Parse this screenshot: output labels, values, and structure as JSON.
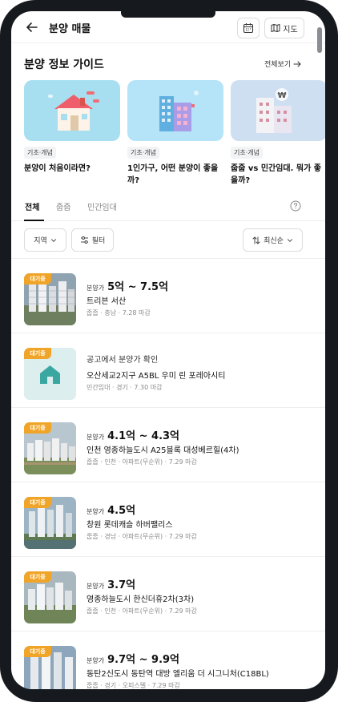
{
  "header": {
    "title": "분양 매물",
    "map_label": "지도"
  },
  "guide": {
    "title": "분양 정보 가이드",
    "see_all": "전체보기",
    "cards": [
      {
        "tag": "기초·개념",
        "title": "분양이 처음이라면?",
        "thumb_color": "#a8dff0"
      },
      {
        "tag": "기초·개념",
        "title": "1인가구, 어떤 분양이 좋을까?",
        "thumb_color": "#b5e3f7"
      },
      {
        "tag": "기초·개념",
        "title": "줍줍 vs 민간임대. 뭐가 좋을까?",
        "thumb_color": "#cfdff2"
      }
    ]
  },
  "tabs": [
    "전체",
    "줍줍",
    "민간임대"
  ],
  "filters": {
    "region": "지역",
    "filter": "필터",
    "sort": "최신순"
  },
  "listings": [
    {
      "badge": "대기중",
      "price_label": "분양가",
      "price": "5억 ~ 7.5억",
      "name": "트리븐 서산",
      "meta": "줍줍 · 충남 · 7.28 마감",
      "thumb": "city1"
    },
    {
      "badge": "대기중",
      "notice": "공고에서 분양가 확인",
      "name": "오산세교2지구 A5BL 우미 린 포레아시티",
      "meta": "민간임대 · 경기 · 7.30 마감",
      "thumb": "house"
    },
    {
      "badge": "대기중",
      "price_label": "분양가",
      "price": "4.1억 ~ 4.3억",
      "name": "인천 영종하늘도시 A25블록 대성베르힐(4차)",
      "meta": "줍줍 · 인천 · 아파트(무순위) · 7.29 마감",
      "thumb": "city2"
    },
    {
      "badge": "대기중",
      "price_label": "분양가",
      "price": "4.5억",
      "name": "창원 롯데캐슬 하버팰리스",
      "meta": "줍줍 · 경남 · 아파트(무순위) · 7.29 마감",
      "thumb": "city3"
    },
    {
      "badge": "대기중",
      "price_label": "분양가",
      "price": "3.7억",
      "name": "영종하늘도시 한신더휴2차(3차)",
      "meta": "줍줍 · 인천 · 아파트(무순위) · 7.29 마감",
      "thumb": "city4"
    },
    {
      "badge": "대기중",
      "price_label": "분양가",
      "price": "9.7억 ~ 9.9억",
      "name": "동탄2신도시 동탄역 대방 엘리움 더 시그니처(C18BL)",
      "meta": "줍줍 · 경기 · 오피스텔 · 7.29 마감",
      "thumb": "city5"
    }
  ],
  "colors": {
    "badge": "#f0a529",
    "text": "#111111",
    "muted": "#8a8a8a"
  }
}
